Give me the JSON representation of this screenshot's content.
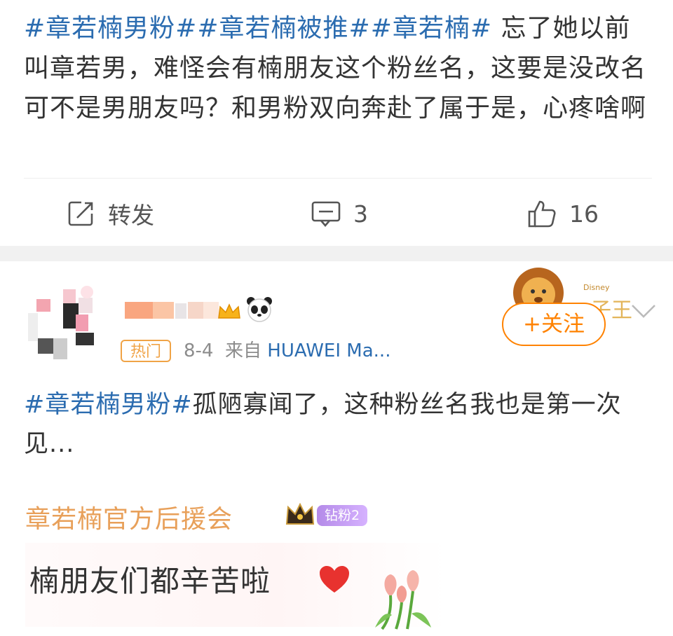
{
  "post1": {
    "topics": [
      "#章若楠男粉#",
      "#章若楠被推#",
      "#章若楠#"
    ],
    "body": " 忘了她以前叫章若男，难怪会有楠朋友这个粉丝名，这要是没改名可不是男朋友吗？和男粉双向奔赴了属于是，心疼啥啊",
    "actions": {
      "repost_icon": "share-icon",
      "repost_label": "转发",
      "comment_icon": "comment-icon",
      "comment_count": "3",
      "like_icon": "thumbs-up-icon",
      "like_count": "16"
    }
  },
  "post2": {
    "badge": "热门",
    "date": "8-4",
    "source_prefix": "来自",
    "device": "HUAWEI Ma...",
    "follow_label": "+关注",
    "lion_text": "子王",
    "topic": "#章若楠男粉#",
    "body": "孤陋寡闻了，这种粉丝名我也是第一次见...",
    "signature": {
      "name": "章若楠官方后援会",
      "fan_badge": "钻粉2",
      "message": "楠朋友们都辛苦啦"
    }
  },
  "colors": {
    "topic": "#2b6cb0",
    "follow": "#ff8200",
    "hot": "#f0a346",
    "signature": "#e8a05a"
  }
}
